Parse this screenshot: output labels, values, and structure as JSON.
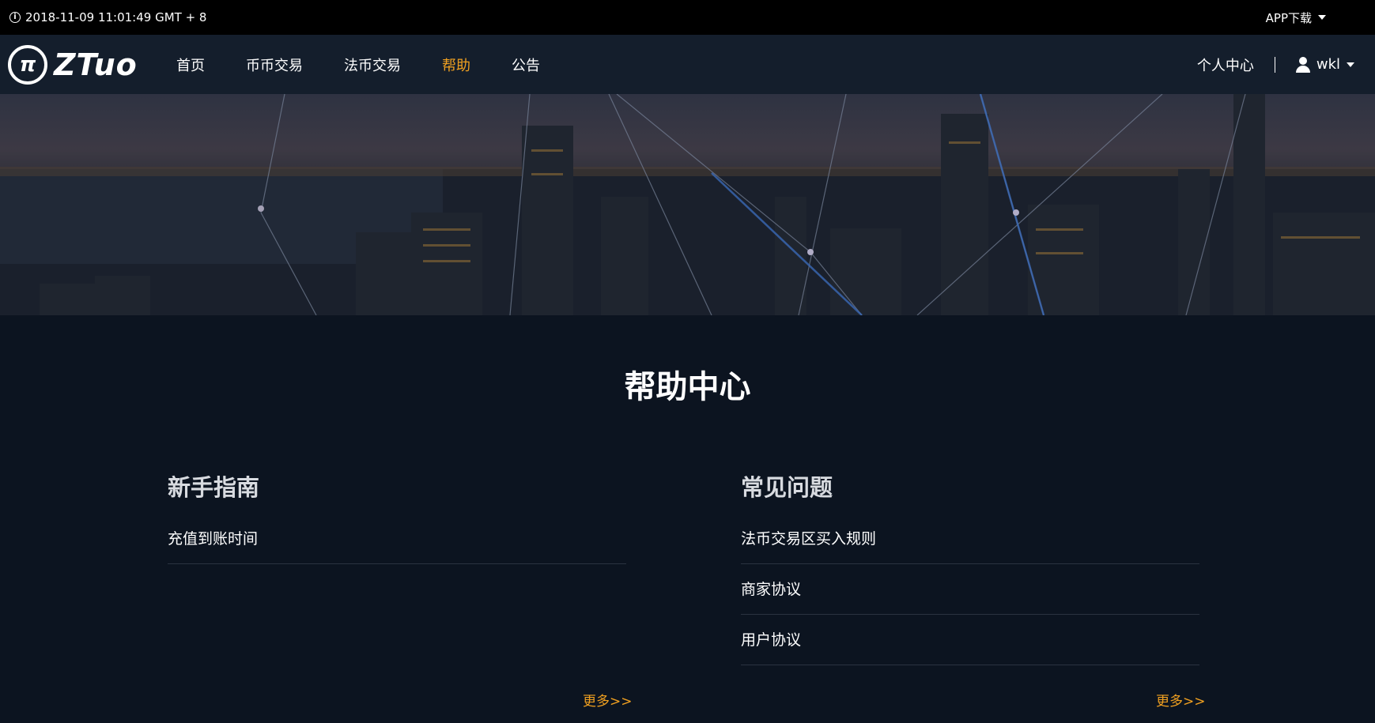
{
  "topbar": {
    "datetime": "2018-11-09 11:01:49  GMT + 8",
    "app_download": "APP下载",
    "icons": {
      "info": "info-circle-icon",
      "caret": "chevron-down-icon"
    }
  },
  "navbar": {
    "logo_text": "ZTuo",
    "links": [
      {
        "label": "首页"
      },
      {
        "label": "币币交易"
      },
      {
        "label": "法币交易"
      },
      {
        "label": "帮助"
      },
      {
        "label": "公告"
      }
    ],
    "active_index": 3,
    "personal_center": "个人中心",
    "username": "wkl",
    "accent_color": "#f0a020"
  },
  "page": {
    "title": "帮助中心"
  },
  "sections": {
    "beginner": {
      "title": "新手指南",
      "items": [
        "充值到账时间"
      ],
      "more": "更多>>"
    },
    "faq": {
      "title": "常见问题",
      "items": [
        "法币交易区买入规则",
        "商家协议",
        "用户协议"
      ],
      "more": "更多>>"
    }
  }
}
